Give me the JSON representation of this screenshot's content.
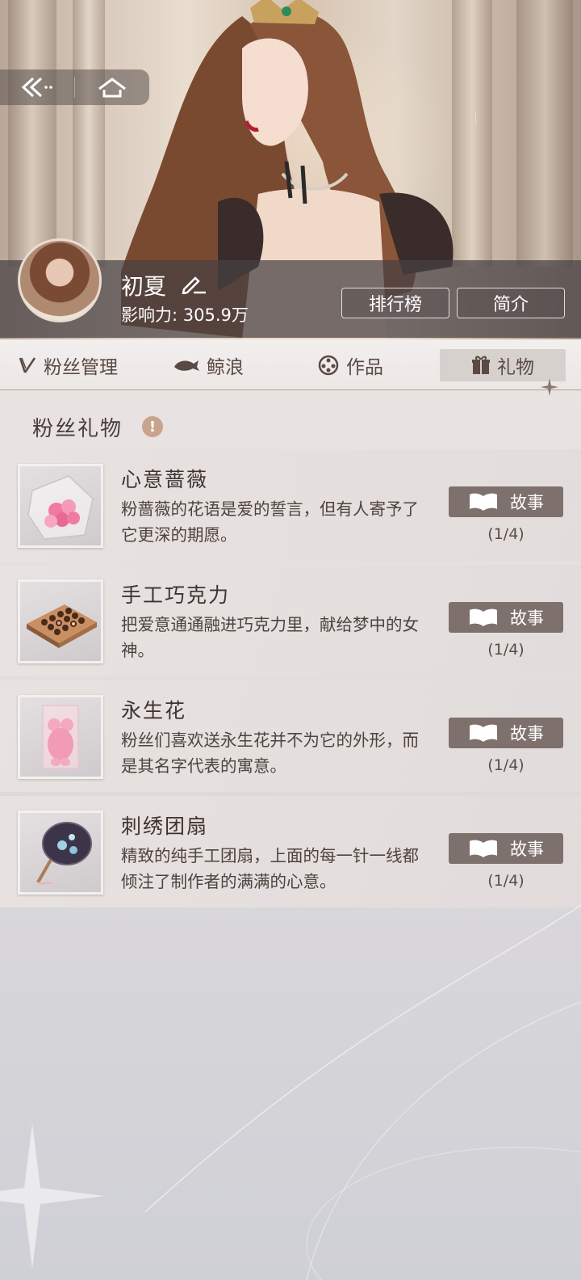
{
  "profile": {
    "name": "初夏",
    "influence_label": "影响力:",
    "influence_value": "305.9万"
  },
  "hero_buttons": {
    "ranking": "排行榜",
    "intro": "简介"
  },
  "tabs": [
    {
      "label": "粉丝管理",
      "icon": "fan-management-icon"
    },
    {
      "label": "鲸浪",
      "icon": "whale-icon"
    },
    {
      "label": "作品",
      "icon": "film-reel-icon"
    },
    {
      "label": "礼物",
      "icon": "gift-icon",
      "active": true
    }
  ],
  "section": {
    "title": "粉丝礼物"
  },
  "gifts": [
    {
      "name": "心意蔷薇",
      "desc": "粉蔷薇的花语是爱的誓言，但有人寄予了它更深的期愿。",
      "story_label": "故事",
      "progress": "(1/4)"
    },
    {
      "name": "手工巧克力",
      "desc": "把爱意通通融进巧克力里，献给梦中的女神。",
      "story_label": "故事",
      "progress": "(1/4)"
    },
    {
      "name": "永生花",
      "desc": "粉丝们喜欢送永生花并不为它的外形，而是其名字代表的寓意。",
      "story_label": "故事",
      "progress": "(1/4)"
    },
    {
      "name": "刺绣团扇",
      "desc": "精致的纯手工团扇，上面的每一针一线都倾注了制作者的满满的心意。",
      "story_label": "故事",
      "progress": "(1/4)"
    }
  ],
  "colors": {
    "story_button": "#7e716d",
    "info_icon": "#c9a48c",
    "profile_bar": "#46404299"
  }
}
